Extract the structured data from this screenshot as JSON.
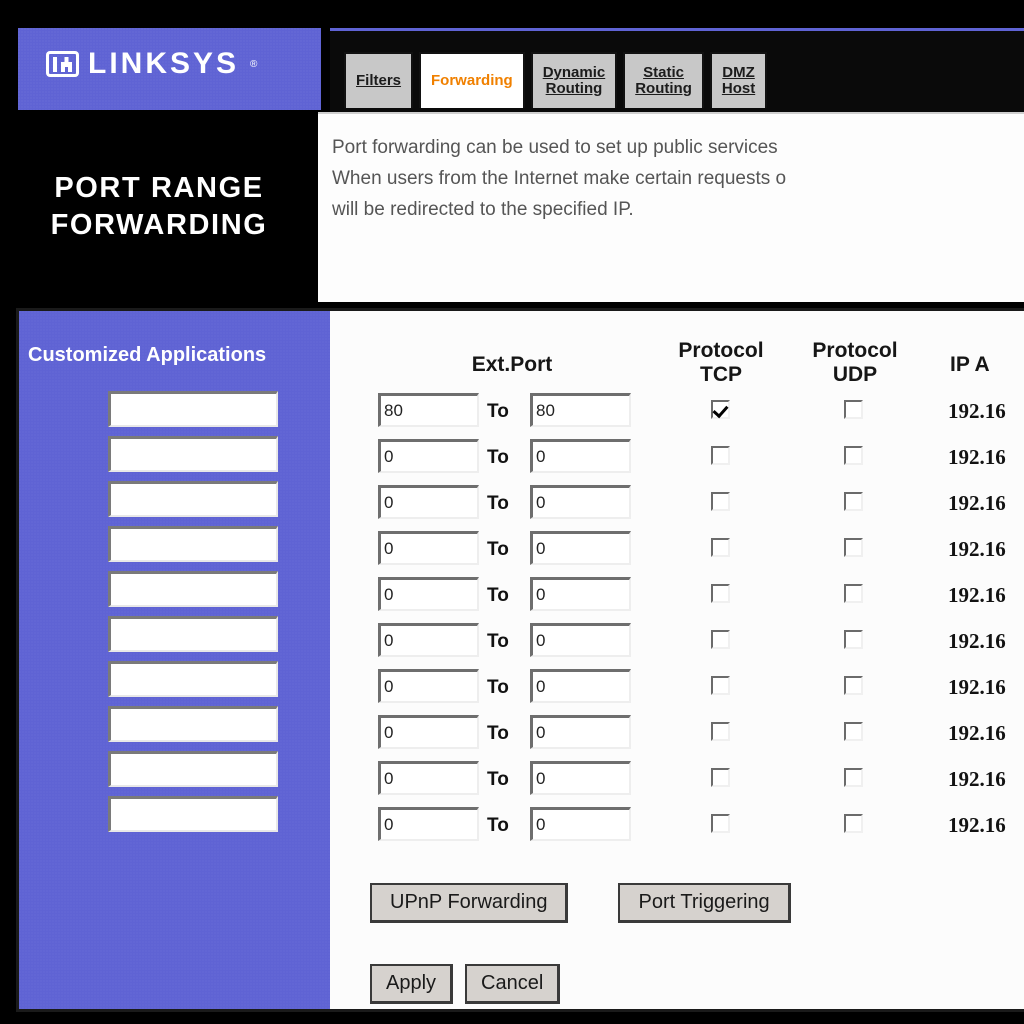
{
  "brand": {
    "name": "LINKSYS",
    "trademark": "®",
    "logo_icon": "linksys-logo-icon",
    "banner_color": "#5f63d4"
  },
  "tabs": [
    {
      "line1": "Filters",
      "line2": "",
      "active": false
    },
    {
      "line1": "Forwarding",
      "line2": "",
      "active": true
    },
    {
      "line1": "Dynamic",
      "line2": "Routing",
      "active": false
    },
    {
      "line1": "Static",
      "line2": "Routing",
      "active": false
    },
    {
      "line1": "DMZ",
      "line2": "Host",
      "active": false
    }
  ],
  "page_title": {
    "line1": "PORT RANGE",
    "line2": "FORWARDING"
  },
  "description": [
    "Port forwarding can be used to set up public services",
    "When users from the Internet make certain requests o",
    "will be redirected to the specified IP."
  ],
  "apps_panel": {
    "heading": "Customized Applications",
    "field_count": 10,
    "field_values": [
      "",
      "",
      "",
      "",
      "",
      "",
      "",
      "",
      "",
      ""
    ],
    "panel_color": "#5f63d4"
  },
  "table": {
    "headers": {
      "ext_port": "Ext.Port",
      "protocol_tcp_line1": "Protocol",
      "protocol_tcp_line2": "TCP",
      "protocol_udp_line1": "Protocol",
      "protocol_udp_line2": "UDP",
      "ip_address": "IP A"
    },
    "to_label": "To",
    "rows": [
      {
        "port_start": "80",
        "port_end": "80",
        "tcp": true,
        "udp": false,
        "ip": "192.16"
      },
      {
        "port_start": "0",
        "port_end": "0",
        "tcp": false,
        "udp": false,
        "ip": "192.16"
      },
      {
        "port_start": "0",
        "port_end": "0",
        "tcp": false,
        "udp": false,
        "ip": "192.16"
      },
      {
        "port_start": "0",
        "port_end": "0",
        "tcp": false,
        "udp": false,
        "ip": "192.16"
      },
      {
        "port_start": "0",
        "port_end": "0",
        "tcp": false,
        "udp": false,
        "ip": "192.16"
      },
      {
        "port_start": "0",
        "port_end": "0",
        "tcp": false,
        "udp": false,
        "ip": "192.16"
      },
      {
        "port_start": "0",
        "port_end": "0",
        "tcp": false,
        "udp": false,
        "ip": "192.16"
      },
      {
        "port_start": "0",
        "port_end": "0",
        "tcp": false,
        "udp": false,
        "ip": "192.16"
      },
      {
        "port_start": "0",
        "port_end": "0",
        "tcp": false,
        "udp": false,
        "ip": "192.16"
      },
      {
        "port_start": "0",
        "port_end": "0",
        "tcp": false,
        "udp": false,
        "ip": "192.16"
      }
    ]
  },
  "buttons": {
    "upnp_forwarding": "UPnP Forwarding",
    "port_triggering": "Port Triggering",
    "apply": "Apply",
    "cancel": "Cancel"
  }
}
